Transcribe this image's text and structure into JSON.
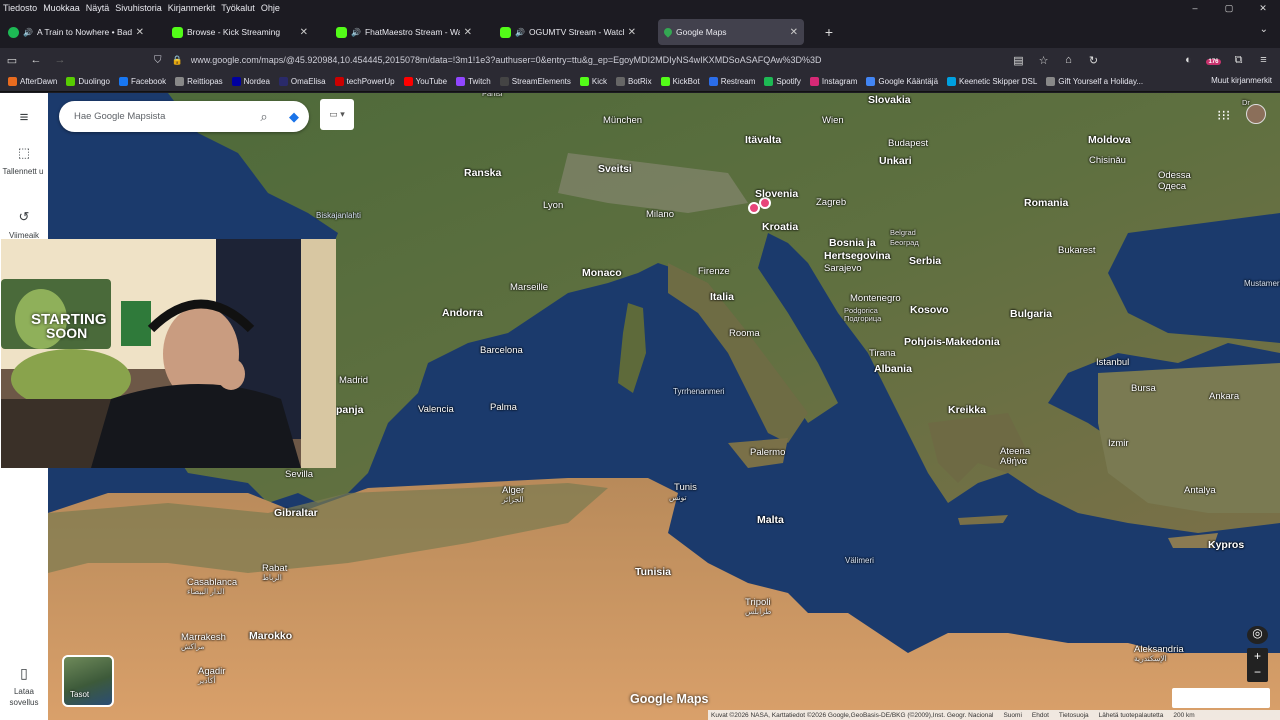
{
  "menu": [
    "Tiedosto",
    "Muokkaa",
    "Näytä",
    "Sivuhistoria",
    "Kirjanmerkit",
    "Työkalut",
    "Ohje"
  ],
  "window_controls": [
    "–",
    "▢",
    "✕"
  ],
  "tabs": [
    {
      "title": "A Train to Nowhere • Bad B",
      "icon_color": "#1db954",
      "audio": true
    },
    {
      "title": "Browse - Kick Streaming",
      "icon_color": "#53fc18",
      "audio": false
    },
    {
      "title": "FhatMaestro Stream - Watc",
      "icon_color": "#53fc18",
      "audio": true
    },
    {
      "title": "OGUMTV Stream - Watch L",
      "icon_color": "#53fc18",
      "audio": true
    },
    {
      "title": "Google Maps",
      "icon_color": "#34a853",
      "audio": false
    }
  ],
  "url": "www.google.com/maps/@45.920984,10.454445,2015078m/data=!3m1!1e3?authuser=0&entry=ttu&g_ep=EgoyMDI2MDIyNS4wIKXMDSoASAFQAw%3D%3D",
  "nav_badge": "176",
  "bookmarks": [
    {
      "label": "AfterDawn",
      "color": "#e86b1f"
    },
    {
      "label": "Duolingo",
      "color": "#58cc02"
    },
    {
      "label": "Facebook",
      "color": "#1877f2"
    },
    {
      "label": "Reittiopas",
      "color": "#888"
    },
    {
      "label": "Nordea",
      "color": "#0000a0"
    },
    {
      "label": "OmaElisa",
      "color": "#2a2a6a"
    },
    {
      "label": "techPowerUp",
      "color": "#c00"
    },
    {
      "label": "YouTube",
      "color": "#f00"
    },
    {
      "label": "Twitch",
      "color": "#9146ff"
    },
    {
      "label": "StreamElements",
      "color": "#444"
    },
    {
      "label": "Kick",
      "color": "#53fc18"
    },
    {
      "label": "BotRix",
      "color": "#666"
    },
    {
      "label": "KickBot",
      "color": "#53fc18"
    },
    {
      "label": "Restream",
      "color": "#2b6de9"
    },
    {
      "label": "Spotify",
      "color": "#1db954"
    },
    {
      "label": "Instagram",
      "color": "#d62976"
    },
    {
      "label": "Google Kääntäjä",
      "color": "#4285f4"
    },
    {
      "label": "Keenetic Skipper DSL",
      "color": "#00a0e0"
    },
    {
      "label": "Gift Yourself a Holiday...",
      "color": "#888"
    }
  ],
  "bookmarks_other": "Muut kirjanmerkit",
  "search": {
    "placeholder": "Hae Google Mapsista"
  },
  "rail": {
    "saved": "Tallennett u",
    "recent": "Viimeaik",
    "download": "Lataa sovellus"
  },
  "layers_label": "Tasot",
  "logo": "Google Maps",
  "attribution": [
    "Kuvat ©2026 NASA, Karttatiedot ©2026 Google,GeoBasis-DE/BKG (©2009),Inst. Geogr. Nacional",
    "Suomi",
    "Ehdot",
    "Tietosuoja",
    "Lähetä tuotepalautetta",
    "200 km"
  ],
  "webcam_text": [
    "STARTING",
    "SOON"
  ],
  "map_labels": [
    {
      "t": "Pariisi",
      "c": "sub"
    },
    {
      "t": "Slovakia",
      "c": "country"
    },
    {
      "t": "Dr",
      "c": "sub"
    },
    {
      "t": "München",
      "c": ""
    },
    {
      "t": "Wien",
      "c": ""
    },
    {
      "t": "Itävalta",
      "c": "country"
    },
    {
      "t": "Moldova",
      "c": "country"
    },
    {
      "t": "Budapest",
      "c": ""
    },
    {
      "t": "Unkari",
      "c": "country"
    },
    {
      "t": "Chisinău",
      "c": ""
    },
    {
      "t": "Ranska",
      "c": "country"
    },
    {
      "t": "Sveitsi",
      "c": "country"
    },
    {
      "t": "Odessa",
      "c": ""
    },
    {
      "t": "Одеса",
      "c": ""
    },
    {
      "t": "Slovenia",
      "c": "country"
    },
    {
      "t": "Zagreb",
      "c": ""
    },
    {
      "t": "Lyon",
      "c": ""
    },
    {
      "t": "Romania",
      "c": "country"
    },
    {
      "t": "Biskajanlahti",
      "c": "small"
    },
    {
      "t": "Milano",
      "c": ""
    },
    {
      "t": "Kroatia",
      "c": "country"
    },
    {
      "t": "Belgrad",
      "c": "sub"
    },
    {
      "t": "Београд",
      "c": "sub"
    },
    {
      "t": "Bosnia ja",
      "c": "country"
    },
    {
      "t": "Hertsegovina",
      "c": "country"
    },
    {
      "t": "Bukarest",
      "c": ""
    },
    {
      "t": "Sarajevo",
      "c": ""
    },
    {
      "t": "Serbia",
      "c": "country"
    },
    {
      "t": "Monaco",
      "c": "country"
    },
    {
      "t": "Firenze",
      "c": ""
    },
    {
      "t": "Mustameri",
      "c": "small"
    },
    {
      "t": "Marseille",
      "c": ""
    },
    {
      "t": "Italia",
      "c": "country"
    },
    {
      "t": "Montenegro",
      "c": ""
    },
    {
      "t": "Подгорица",
      "c": "sub"
    },
    {
      "t": "Podgorica",
      "c": "sub"
    },
    {
      "t": "Kosovo",
      "c": "country"
    },
    {
      "t": "Andorra",
      "c": "country"
    },
    {
      "t": "Bulgaria",
      "c": "country"
    },
    {
      "t": "Rooma",
      "c": ""
    },
    {
      "t": "Pohjois-Makedonia",
      "c": "country"
    },
    {
      "t": "Barcelona",
      "c": ""
    },
    {
      "t": "Tirana",
      "c": ""
    },
    {
      "t": "Albania",
      "c": "country"
    },
    {
      "t": "Istanbul",
      "c": ""
    },
    {
      "t": "Madrid",
      "c": ""
    },
    {
      "t": "Tyrrhenanmeri",
      "c": "small"
    },
    {
      "t": "Bursa",
      "c": ""
    },
    {
      "t": "Ankara",
      "c": ""
    },
    {
      "t": "panja",
      "c": "country"
    },
    {
      "t": "Valencia",
      "c": ""
    },
    {
      "t": "Palma",
      "c": ""
    },
    {
      "t": "Kreikka",
      "c": "country"
    },
    {
      "t": "Ateena",
      "c": ""
    },
    {
      "t": "Αθήνα",
      "c": ""
    },
    {
      "t": "Izmir",
      "c": ""
    },
    {
      "t": "Palermo",
      "c": ""
    },
    {
      "t": "Sevilla",
      "c": ""
    },
    {
      "t": "Antalya",
      "c": ""
    },
    {
      "t": "Gibraltar",
      "c": "country"
    },
    {
      "t": "Alger",
      "c": ""
    },
    {
      "t": "الجزائر",
      "c": "sub"
    },
    {
      "t": "Tunis",
      "c": ""
    },
    {
      "t": "تونس",
      "c": "sub"
    },
    {
      "t": "Malta",
      "c": "country"
    },
    {
      "t": "Kypros",
      "c": "country"
    },
    {
      "t": "Välimeri",
      "c": "small"
    },
    {
      "t": "Rabat",
      "c": ""
    },
    {
      "t": "الرباط",
      "c": "sub"
    },
    {
      "t": "Casablanca",
      "c": ""
    },
    {
      "t": "الدار البيضاء",
      "c": "sub"
    },
    {
      "t": "Tunisia",
      "c": "country"
    },
    {
      "t": "Tripoli",
      "c": ""
    },
    {
      "t": "طرابلس",
      "c": "sub"
    },
    {
      "t": "Marrakesh",
      "c": ""
    },
    {
      "t": "مراكش",
      "c": "sub"
    },
    {
      "t": "Marokko",
      "c": "country"
    },
    {
      "t": "Agadir",
      "c": ""
    },
    {
      "t": "أكادير",
      "c": "sub"
    },
    {
      "t": "Aleksandria",
      "c": ""
    },
    {
      "t": "الإسكندرية",
      "c": "sub"
    }
  ]
}
